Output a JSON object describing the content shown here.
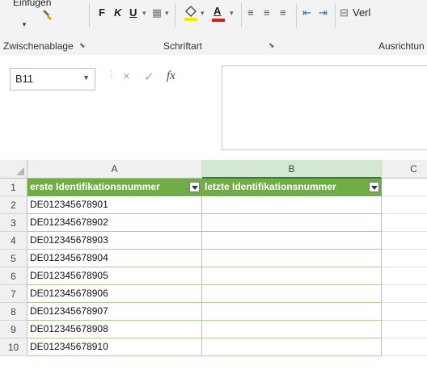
{
  "ribbon": {
    "paste_label": "Einfügen",
    "font_buttons": {
      "bold": "F",
      "italic": "K",
      "underline": "U"
    },
    "groups": {
      "clipboard": "Zwischenablage",
      "font": "Schriftart",
      "alignment": "Ausrichtun"
    },
    "wrap_text_partial": "Verl"
  },
  "formula_bar": {
    "name_box": "B11",
    "fx": "fx",
    "cancel": "×",
    "enter": "✓",
    "value": ""
  },
  "grid": {
    "columns": [
      "A",
      "B",
      "C"
    ],
    "header_row": {
      "number": "1",
      "a": "erste Identifikationsnummer",
      "b": "letzte Identifikationsnummer"
    },
    "rows": [
      {
        "number": "2",
        "a": "DE012345678901",
        "b": ""
      },
      {
        "number": "3",
        "a": "DE012345678902",
        "b": ""
      },
      {
        "number": "4",
        "a": "DE012345678903",
        "b": ""
      },
      {
        "number": "5",
        "a": "DE012345678904",
        "b": ""
      },
      {
        "number": "6",
        "a": "DE012345678905",
        "b": ""
      },
      {
        "number": "7",
        "a": "DE012345678906",
        "b": ""
      },
      {
        "number": "8",
        "a": "DE012345678907",
        "b": ""
      },
      {
        "number": "9",
        "a": "DE012345678908",
        "b": ""
      },
      {
        "number": "10",
        "a": "DE012345678910",
        "b": ""
      }
    ]
  },
  "colors": {
    "table_header": "#70ad47",
    "accent": "#2e7d32"
  }
}
